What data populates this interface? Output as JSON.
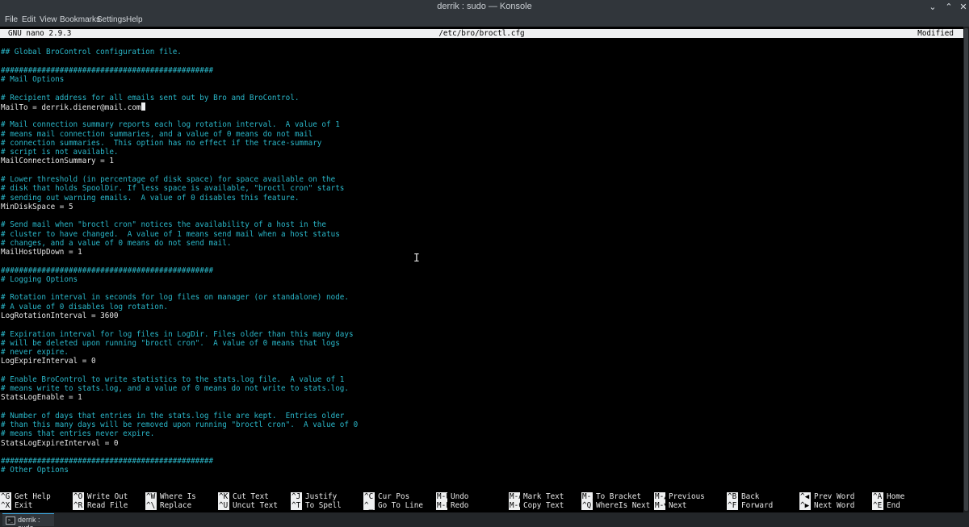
{
  "window": {
    "title": "derrik : sudo — Konsole",
    "minimize_glyph": "⌄",
    "maximize_glyph": "⌃",
    "close_glyph": "✕"
  },
  "menu": [
    "File",
    "Edit",
    "View",
    "Bookmarks",
    "Settings",
    "Help"
  ],
  "nano": {
    "version": "GNU nano 2.9.3",
    "filename": "/etc/bro/broctl.cfg",
    "status": "Modified"
  },
  "lines": [
    {
      "text": "",
      "kind": "code"
    },
    {
      "text": "## Global BroControl configuration file.",
      "kind": "comment"
    },
    {
      "text": "",
      "kind": "code"
    },
    {
      "text": "###############################################",
      "kind": "comment"
    },
    {
      "text": "# Mail Options",
      "kind": "comment"
    },
    {
      "text": "",
      "kind": "code"
    },
    {
      "text": "# Recipient address for all emails sent out by Bro and BroControl.",
      "kind": "comment"
    },
    {
      "text": "MailTo = derrik.diener@mail.com",
      "kind": "code",
      "cursor": true
    },
    {
      "text": "",
      "kind": "code"
    },
    {
      "text": "# Mail connection summary reports each log rotation interval.  A value of 1",
      "kind": "comment"
    },
    {
      "text": "# means mail connection summaries, and a value of 0 means do not mail",
      "kind": "comment"
    },
    {
      "text": "# connection summaries.  This option has no effect if the trace-summary",
      "kind": "comment"
    },
    {
      "text": "# script is not available.",
      "kind": "comment"
    },
    {
      "text": "MailConnectionSummary = 1",
      "kind": "code"
    },
    {
      "text": "",
      "kind": "code"
    },
    {
      "text": "# Lower threshold (in percentage of disk space) for space available on the",
      "kind": "comment"
    },
    {
      "text": "# disk that holds SpoolDir. If less space is available, \"broctl cron\" starts",
      "kind": "comment"
    },
    {
      "text": "# sending out warning emails.  A value of 0 disables this feature.",
      "kind": "comment"
    },
    {
      "text": "MinDiskSpace = 5",
      "kind": "code"
    },
    {
      "text": "",
      "kind": "code"
    },
    {
      "text": "# Send mail when \"broctl cron\" notices the availability of a host in the",
      "kind": "comment"
    },
    {
      "text": "# cluster to have changed.  A value of 1 means send mail when a host status",
      "kind": "comment"
    },
    {
      "text": "# changes, and a value of 0 means do not send mail.",
      "kind": "comment"
    },
    {
      "text": "MailHostUpDown = 1",
      "kind": "code"
    },
    {
      "text": "",
      "kind": "code"
    },
    {
      "text": "###############################################",
      "kind": "comment"
    },
    {
      "text": "# Logging Options",
      "kind": "comment"
    },
    {
      "text": "",
      "kind": "code"
    },
    {
      "text": "# Rotation interval in seconds for log files on manager (or standalone) node.",
      "kind": "comment"
    },
    {
      "text": "# A value of 0 disables log rotation.",
      "kind": "comment"
    },
    {
      "text": "LogRotationInterval = 3600",
      "kind": "code"
    },
    {
      "text": "",
      "kind": "code"
    },
    {
      "text": "# Expiration interval for log files in LogDir. Files older than this many days",
      "kind": "comment"
    },
    {
      "text": "# will be deleted upon running \"broctl cron\".  A value of 0 means that logs",
      "kind": "comment"
    },
    {
      "text": "# never expire.",
      "kind": "comment"
    },
    {
      "text": "LogExpireInterval = 0",
      "kind": "code"
    },
    {
      "text": "",
      "kind": "code"
    },
    {
      "text": "# Enable BroControl to write statistics to the stats.log file.  A value of 1",
      "kind": "comment"
    },
    {
      "text": "# means write to stats.log, and a value of 0 means do not write to stats.log.",
      "kind": "comment"
    },
    {
      "text": "StatsLogEnable = 1",
      "kind": "code"
    },
    {
      "text": "",
      "kind": "code"
    },
    {
      "text": "# Number of days that entries in the stats.log file are kept.  Entries older",
      "kind": "comment"
    },
    {
      "text": "# than this many days will be removed upon running \"broctl cron\".  A value of 0",
      "kind": "comment"
    },
    {
      "text": "# means that entries never expire.",
      "kind": "comment"
    },
    {
      "text": "StatsLogExpireInterval = 0",
      "kind": "code"
    },
    {
      "text": "",
      "kind": "code"
    },
    {
      "text": "###############################################",
      "kind": "comment"
    },
    {
      "text": "# Other Options",
      "kind": "comment"
    }
  ],
  "shortcuts_top": [
    {
      "key": "^G",
      "label": "Get Help"
    },
    {
      "key": "^O",
      "label": "Write Out"
    },
    {
      "key": "^W",
      "label": "Where Is"
    },
    {
      "key": "^K",
      "label": "Cut Text"
    },
    {
      "key": "^J",
      "label": "Justify"
    },
    {
      "key": "^C",
      "label": "Cur Pos"
    },
    {
      "key": "M-U",
      "label": "Undo"
    },
    {
      "key": "M-A",
      "label": "Mark Text"
    },
    {
      "key": "M-]",
      "label": "To Bracket"
    },
    {
      "key": "M-▲",
      "label": "Previous"
    },
    {
      "key": "^B",
      "label": "Back"
    },
    {
      "key": "^◀",
      "label": "Prev Word"
    },
    {
      "key": "^A",
      "label": "Home"
    }
  ],
  "shortcuts_bottom": [
    {
      "key": "^X",
      "label": "Exit"
    },
    {
      "key": "^R",
      "label": "Read File"
    },
    {
      "key": "^\\",
      "label": "Replace"
    },
    {
      "key": "^U",
      "label": "Uncut Text"
    },
    {
      "key": "^T",
      "label": "To Spell"
    },
    {
      "key": "^_",
      "label": "Go To Line"
    },
    {
      "key": "M-E",
      "label": "Redo"
    },
    {
      "key": "M-6",
      "label": "Copy Text"
    },
    {
      "key": "^Q",
      "label": "WhereIs Next"
    },
    {
      "key": "M-▼",
      "label": "Next"
    },
    {
      "key": "^F",
      "label": "Forward"
    },
    {
      "key": "^▶",
      "label": "Next Word"
    },
    {
      "key": "^E",
      "label": "End"
    }
  ],
  "tab": {
    "label": "derrik : sudo",
    "icon_text": ">_"
  }
}
